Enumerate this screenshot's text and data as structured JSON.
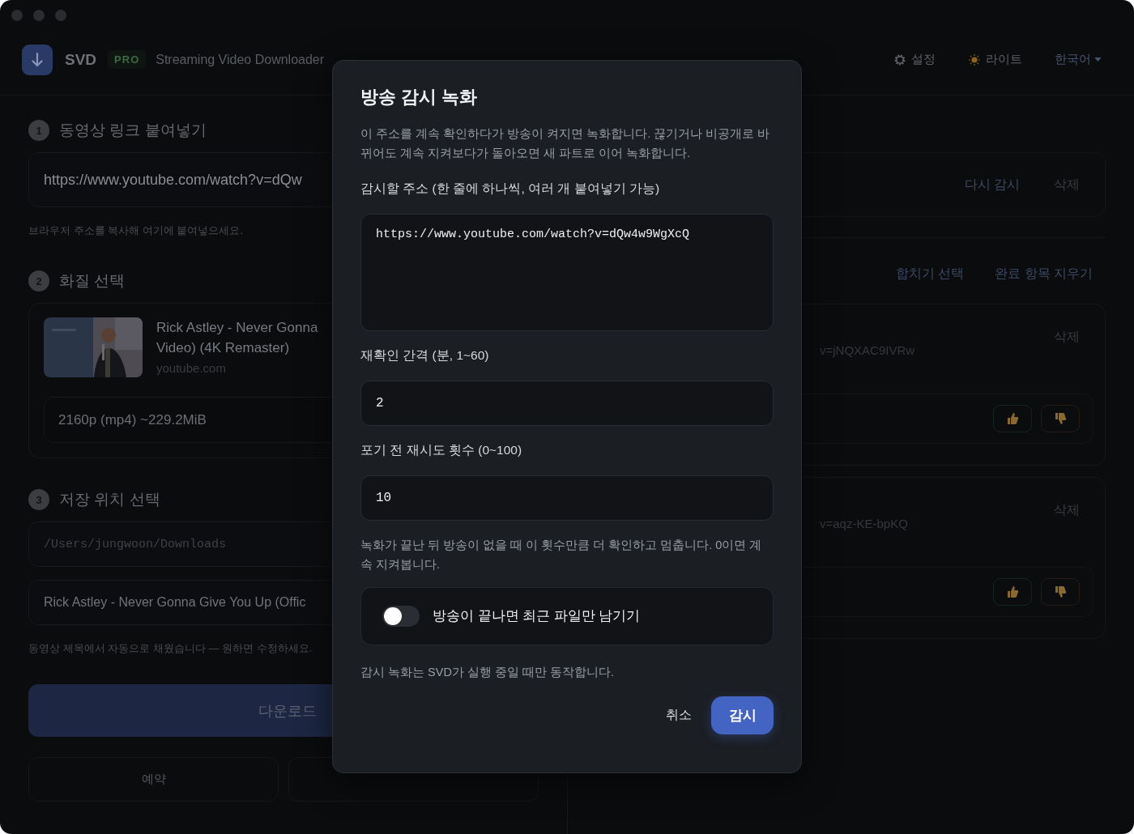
{
  "header": {
    "app_name": "SVD",
    "badge": "PRO",
    "subtitle": "Streaming Video Downloader",
    "actions": [
      {
        "kind": "settings",
        "label": "설정"
      },
      {
        "kind": "theme",
        "label": "라이트"
      }
    ],
    "language": "한국어"
  },
  "steps": [
    {
      "number": "1",
      "title": "동영상 링크 붙여넣기",
      "kind": "link",
      "value": "https://www.youtube.com/watch?v=dQw",
      "hint": "브라우저 주소를 복사해 여기에 붙여넣으세요."
    },
    {
      "number": "2",
      "title": "화질 선택",
      "kind": "quality",
      "video": {
        "title_lines": [
          "Rick Astley - Never Gonna",
          "Video) (4K Remaster)"
        ],
        "source": "youtube.com"
      },
      "format": "2160p (mp4) ~229.2MiB"
    },
    {
      "number": "3",
      "title": "저장 위치 선택",
      "kind": "location",
      "path": "/Users/jungwoon/Downloads",
      "filename": "Rick Astley - Never Gonna Give You Up (Offic",
      "hint": "동영상 제목에서 자동으로 채웠습니다 — 원하면 수정하세요."
    }
  ],
  "download_button": "다운로드",
  "secondary_buttons": [
    "예약"
  ],
  "monitor_card": {
    "actions": [
      "다시 감시",
      "삭제"
    ]
  },
  "queue": {
    "actions": [
      "합치기 선택",
      "완료 항목 지우기"
    ],
    "items": [
      {
        "url": "v=jNQXAC9IVRw",
        "delete": "삭제"
      },
      {
        "url": "v=aqz-KE-bpKQ",
        "delete": "삭제"
      }
    ]
  },
  "modal": {
    "title": "방송 감시 녹화",
    "description": "이 주소를 계속 확인하다가 방송이 켜지면 녹화합니다. 끊기거나 비공개로 바뀌어도 계속 지켜보다가 돌아오면 새 파트로 이어 녹화합니다.",
    "fields": [
      {
        "kind": "textarea",
        "label": "감시할 주소 (한 줄에 하나씩, 여러 개 붙여넣기 가능)",
        "value": "https://www.youtube.com/watch?v=dQw4w9WgXcQ"
      },
      {
        "kind": "input",
        "label": "재확인 간격 (분, 1~60)",
        "value": "2"
      },
      {
        "kind": "input",
        "label": "포기 전 재시도 횟수 (0~100)",
        "value": "10",
        "help": "녹화가 끝난 뒤 방송이 없을 때 이 횟수만큼 더 확인하고 멈춥니다. 0이면 계속 지켜봅니다."
      }
    ],
    "toggle": {
      "label": "방송이 끝나면 최근 파일만 남기기",
      "on": false
    },
    "note": "감시 녹화는 SVD가 실행 중일 때만 동작합니다.",
    "cancel": "취소",
    "confirm": "감시"
  }
}
